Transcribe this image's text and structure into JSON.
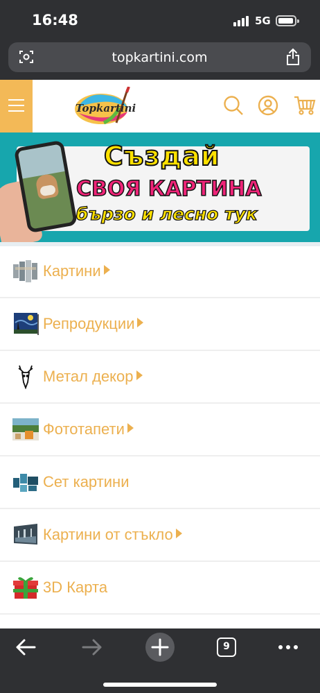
{
  "status_bar": {
    "time": "16:48",
    "network": "5G",
    "battery": "high"
  },
  "browser": {
    "url": "topkartini.com",
    "tab_count": "9"
  },
  "header": {
    "logo_text": "Topkartini",
    "accent_color": "#f3b957",
    "icons": [
      "menu-icon",
      "search-icon",
      "account-icon",
      "cart-icon"
    ]
  },
  "banner": {
    "line1": "Създай",
    "line2": "СВОЯ КАРТИНА",
    "line3": "бързо и лесно тук"
  },
  "menu": {
    "items": [
      {
        "label": "Картини",
        "has_submenu": true
      },
      {
        "label": "Репродукции",
        "has_submenu": true
      },
      {
        "label": "Метал декор",
        "has_submenu": true
      },
      {
        "label": "Фототапети",
        "has_submenu": true
      },
      {
        "label": "Сет картини",
        "has_submenu": false
      },
      {
        "label": "Картини от стъкло",
        "has_submenu": true
      },
      {
        "label": "3D Карта",
        "has_submenu": false
      }
    ],
    "label_color": "#ecb04f"
  },
  "toolbar": {
    "icons": [
      "back-icon",
      "forward-icon",
      "new-tab-icon",
      "tabs-icon",
      "more-icon"
    ]
  }
}
